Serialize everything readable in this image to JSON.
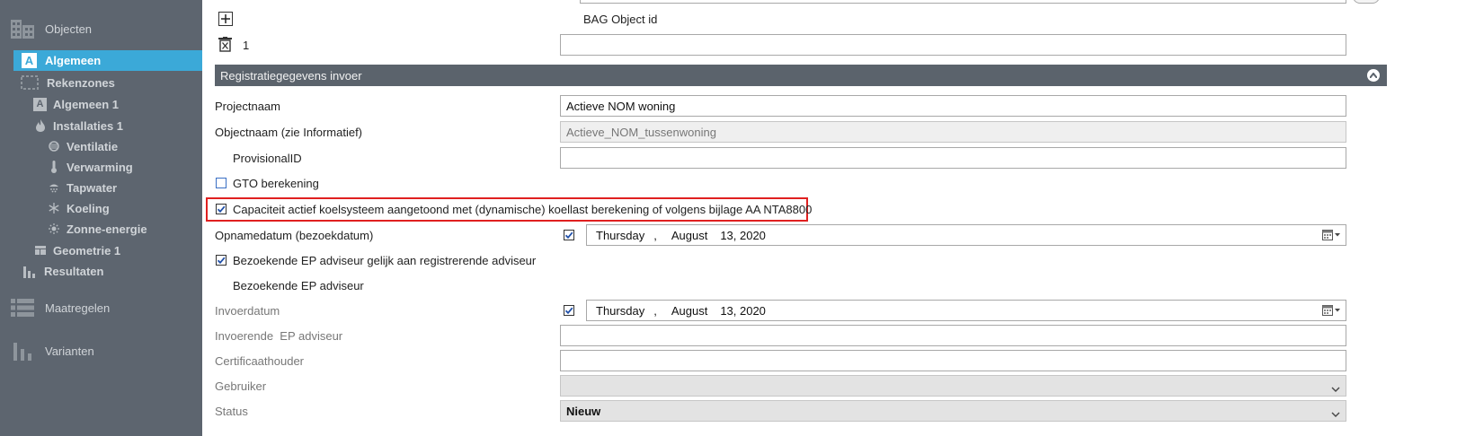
{
  "sidebar": {
    "objecten": "Objecten",
    "algemeen": "Algemeen",
    "rekenzones": "Rekenzones",
    "algemeen1": "Algemeen 1",
    "installaties1": "Installaties 1",
    "ventilatie": "Ventilatie",
    "verwarming": "Verwarming",
    "tapwater": "Tapwater",
    "koeling": "Koeling",
    "zonne_energie": "Zonne-energie",
    "geometrie1": "Geometrie 1",
    "resultaten": "Resultaten",
    "maatregelen": "Maatregelen",
    "varianten": "Varianten",
    "algemeen_badge": "A",
    "algemeen1_badge": "A"
  },
  "top": {
    "bag_label": "BAG Object id",
    "count": "1"
  },
  "section": {
    "title": "Registratiegegevens invoer"
  },
  "form": {
    "projectnaam_label": "Projectnaam",
    "projectnaam_value": "Actieve NOM woning",
    "objectnaam_label": "Objectnaam (zie Informatief)",
    "objectnaam_value": "Actieve_NOM_tussenwoning",
    "provisional_label": "ProvisionalID",
    "gto_label": "GTO berekening",
    "gto_checked": false,
    "capaciteit_label": "Capaciteit actief koelsysteem aangetoond met (dynamische) koellast berekening of volgens bijlage AA NTA8800",
    "capaciteit_checked": true,
    "opnamedatum_label": "Opnamedatum (bezoekdatum)",
    "opname_day": "Thursday",
    "opname_sep": ",",
    "opname_month": "August",
    "opname_date": "13, 2020",
    "bezoekende_gelijk_label": "Bezoekende EP adviseur gelijk aan registrerende adviseur",
    "bezoekende_label": "Bezoekende EP adviseur",
    "invoerdatum_label": "Invoerdatum",
    "invoer_day": "Thursday",
    "invoer_sep": ",",
    "invoer_month": "August",
    "invoer_date": "13, 2020",
    "invoerende_label": "Invoerende  EP adviseur",
    "certificaat_label": "Certificaathouder",
    "gebruiker_label": "Gebruiker",
    "status_label": "Status",
    "status_value": "Nieuw"
  },
  "colors": {
    "sidebar_bg": "#5d656f",
    "active_bg": "#3ba9d8",
    "section_bg": "#5b636c",
    "highlight": "#e02020",
    "check_blue": "#1f4fa8"
  }
}
